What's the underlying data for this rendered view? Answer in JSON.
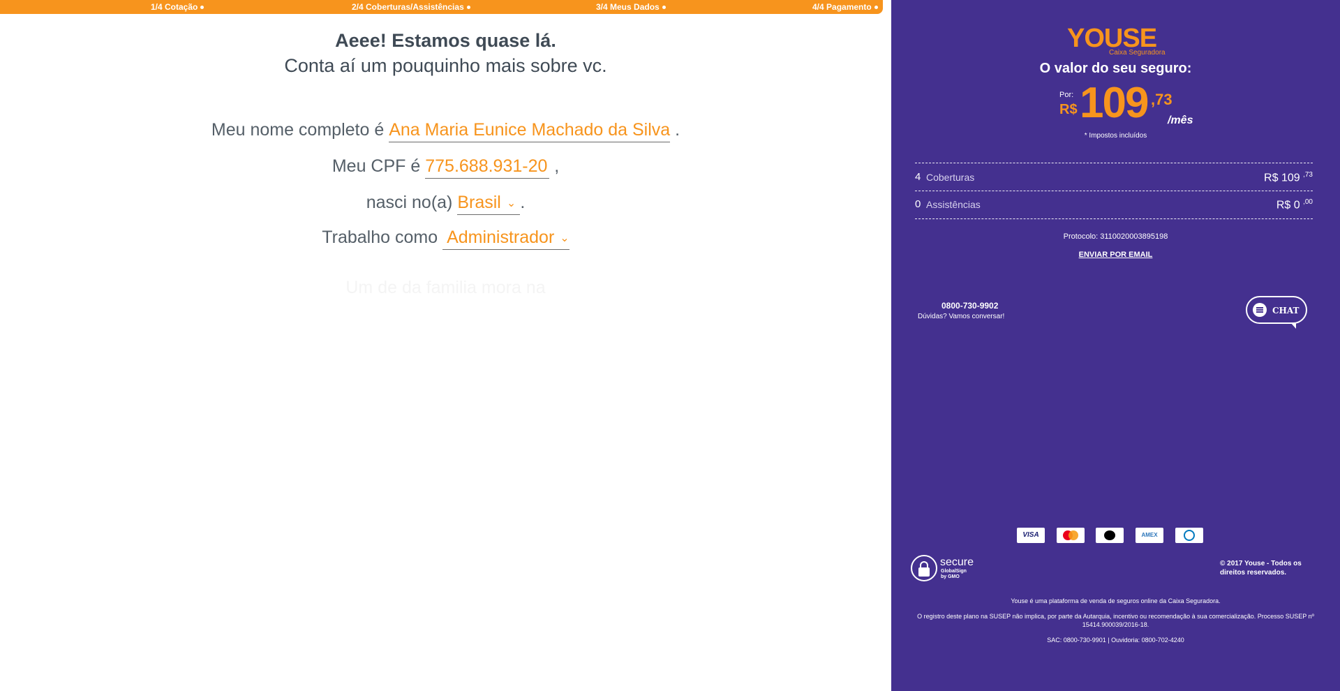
{
  "progress": {
    "steps": [
      {
        "label": "1/4 Cotação"
      },
      {
        "label": "2/4 Coberturas/Assistências"
      },
      {
        "label": "3/4 Meus Dados"
      },
      {
        "label": "4/4 Pagamento"
      }
    ]
  },
  "headline": {
    "line1": "Aeee! Estamos quase lá.",
    "line2": "Conta aí um pouquinho mais sobre vc."
  },
  "form": {
    "name_prefix": "Meu nome completo é",
    "name_value": "Ana Maria Eunice Machado da Silva",
    "name_suffix": ".",
    "cpf_prefix": "Meu CPF é",
    "cpf_value": "775.688.931-20",
    "cpf_suffix": ",",
    "country_prefix": "nasci no(a)",
    "country_value": "Brasil",
    "country_suffix": ".",
    "job_prefix": "Trabalho como",
    "job_value": "Administrador",
    "next_line_faded": "Um de da familia mora na"
  },
  "sidebar": {
    "logo_text": "YOUSE",
    "logo_subtitle": "Caixa Seguradora",
    "value_title": "O valor do seu seguro:",
    "price_prefix": "Por:",
    "currency": "R$",
    "price_int": "109",
    "price_cents": ",73",
    "price_period": "/mês",
    "tax_note": "* Impostos incluídos",
    "coverages": {
      "count": "4",
      "label": "Coberturas",
      "amount": "R$ 109",
      "cents": ",73"
    },
    "assistances": {
      "count": "0",
      "label": "Assistências",
      "amount": "R$ 0",
      "cents": ",00"
    },
    "protocol": "Protocolo: 3110020003895198",
    "email_link": "ENVIAR POR EMAIL",
    "phone": "0800-730-9902",
    "phone_sub": "Dúvidas? Vamos conversar!",
    "chat_label": "CHAT",
    "cards": {
      "visa": "VISA",
      "amex": "AMEX"
    },
    "secure_word": "secure",
    "secure_sub": "GlobalSign",
    "secure_sub2": "by GMO",
    "copyright": "© 2017 Youse - Todos os direitos reservados.",
    "footer1": "Youse é uma plataforma de venda de seguros online da Caixa Seguradora.",
    "footer2": "O registro deste plano na SUSEP não implica, por parte da Autarquia, incentivo ou recomendação à sua comercialização. Processo SUSEP nº 15414.900039/2016-18.",
    "footer3": "SAC: 0800-730-9901 | Ouvidoria: 0800-702-4240"
  },
  "colors": {
    "accent": "#f7941d",
    "sidebar_bg": "#44308f",
    "text": "#555f68"
  }
}
